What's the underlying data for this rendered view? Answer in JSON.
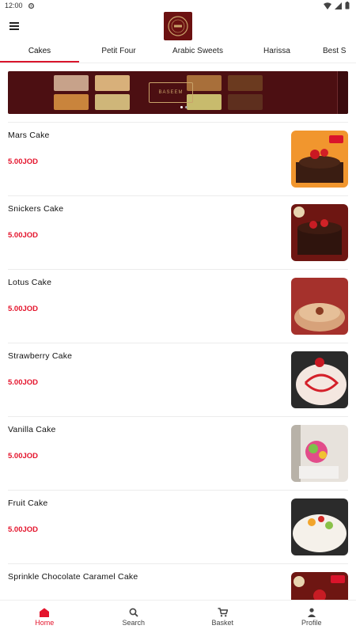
{
  "status_bar": {
    "time": "12:00"
  },
  "tabs": [
    {
      "label": "Cakes"
    },
    {
      "label": "Petit Four"
    },
    {
      "label": "Arabic Sweets"
    },
    {
      "label": "Harissa"
    },
    {
      "label": "Best S"
    }
  ],
  "banner": {
    "brand": "BASEEM"
  },
  "products": [
    {
      "name": "Mars Cake",
      "price": "5.00JOD"
    },
    {
      "name": "Snickers Cake",
      "price": "5.00JOD"
    },
    {
      "name": "Lotus Cake",
      "price": "5.00JOD"
    },
    {
      "name": "Strawberry Cake",
      "price": "5.00JOD"
    },
    {
      "name": "Vanilla Cake",
      "price": "5.00JOD"
    },
    {
      "name": "Fruit Cake",
      "price": "5.00JOD"
    },
    {
      "name": "Sprinkle Chocolate Caramel Cake",
      "price": ""
    }
  ],
  "bottom_nav": {
    "home": "Home",
    "search": "Search",
    "basket": "Basket",
    "profile": "Profile"
  },
  "colors": {
    "accent": "#e4142c",
    "brand_dark": "#6b1111"
  },
  "icons": [
    "gear-icon",
    "wifi-icon",
    "battery-icon",
    "menu-icon",
    "home-icon",
    "search-icon",
    "cart-icon",
    "profile-icon"
  ]
}
